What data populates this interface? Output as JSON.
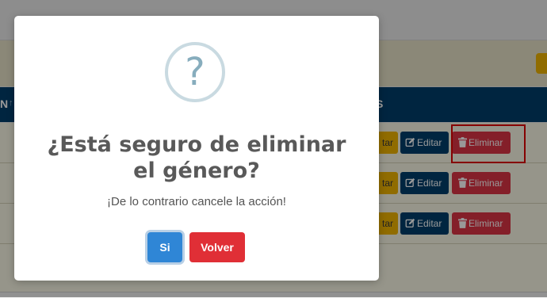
{
  "background": {
    "table_header": {
      "left_label": "N",
      "sort_indicator": "↑",
      "right_label": "S"
    },
    "rows": [
      {
        "warn_label": "tar",
        "edit_label": "Editar",
        "delete_label": "Eliminar"
      },
      {
        "warn_label": "tar",
        "edit_label": "Editar",
        "delete_label": "Eliminar"
      },
      {
        "warn_label": "tar",
        "edit_label": "Editar",
        "delete_label": "Eliminar"
      }
    ]
  },
  "dialog": {
    "icon": "question-icon",
    "icon_glyph": "?",
    "title": "¿Está seguro de eliminar el género?",
    "text": "¡De lo contrario cancele la acción!",
    "confirm_label": "Si",
    "cancel_label": "Volver"
  },
  "colors": {
    "header": "#003e6b",
    "edit": "#003e6b",
    "delete": "#dc3545",
    "warn": "#f0b400",
    "confirm": "#2f86d6",
    "cancel": "#e02f36",
    "highlight": "#e00000"
  }
}
